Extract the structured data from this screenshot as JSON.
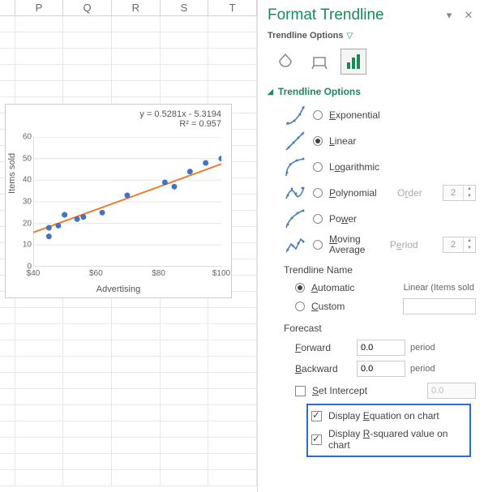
{
  "columns": [
    "P",
    "Q",
    "R",
    "S",
    "T"
  ],
  "chart_data": {
    "type": "scatter",
    "points": [
      {
        "x": 45,
        "y": 18
      },
      {
        "x": 45,
        "y": 14
      },
      {
        "x": 48,
        "y": 19
      },
      {
        "x": 50,
        "y": 24
      },
      {
        "x": 54,
        "y": 22
      },
      {
        "x": 56,
        "y": 23
      },
      {
        "x": 62,
        "y": 25
      },
      {
        "x": 70,
        "y": 33
      },
      {
        "x": 82,
        "y": 39
      },
      {
        "x": 85,
        "y": 37
      },
      {
        "x": 90,
        "y": 44
      },
      {
        "x": 95,
        "y": 48
      },
      {
        "x": 100,
        "y": 50
      }
    ],
    "trendline": {
      "slope": 0.5281,
      "intercept": -5.3194,
      "color": "#ed7d31"
    },
    "xlabel": "Advertising",
    "ylabel": "Items sold",
    "xlim": [
      40,
      100
    ],
    "ylim": [
      0,
      60
    ],
    "xticks": [
      40,
      60,
      80,
      100
    ],
    "yticks": [
      0,
      10,
      20,
      30,
      40,
      50,
      60
    ],
    "xtick_labels": [
      "$40",
      "$60",
      "$80",
      "$100"
    ],
    "equation": "y = 0.5281x - 5.3194",
    "r2": "R² = 0.957"
  },
  "panel": {
    "title": "Format Trendline",
    "sub_title": "Trendline Options",
    "section_title": "Trendline Options",
    "types": {
      "exponential": "Exponential",
      "linear": "Linear",
      "logarithmic": "Logarithmic",
      "polynomial": "Polynomial",
      "power": "Power",
      "moving_avg": "Moving\nAverage"
    },
    "order_label": "Order",
    "order_value": "2",
    "period_label": "Period",
    "period_value": "2",
    "trendline_name_label": "Trendline Name",
    "automatic_label": "Automatic",
    "custom_label": "Custom",
    "automatic_desc": "Linear (Items sold",
    "forecast_label": "Forecast",
    "forward_label": "Forward",
    "backward_label": "Backward",
    "forward_value": "0.0",
    "backward_value": "0.0",
    "period_unit": "period",
    "set_intercept_label": "Set Intercept",
    "set_intercept_value": "0.0",
    "display_equation_label": "Display Equation on chart",
    "display_r2_label": "Display R-squared value on chart"
  }
}
